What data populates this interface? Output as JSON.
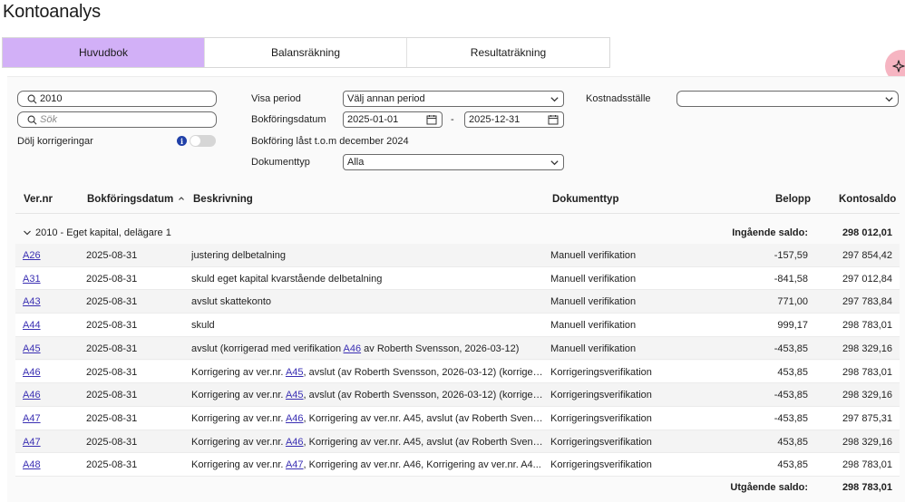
{
  "page": {
    "title": "Kontoanalys"
  },
  "tabs": [
    {
      "label": "Huvudbok",
      "active": true
    },
    {
      "label": "Balansräkning",
      "active": false
    },
    {
      "label": "Resultaträkning",
      "active": false
    }
  ],
  "colors": {
    "active_tab": "#d2b0f7",
    "link": "#3a2fb3",
    "fab": "#f6b5c2",
    "info": "#2040a8"
  },
  "filters": {
    "account_search_value": "2010",
    "search_placeholder": "Sök",
    "hide_corrections_label": "Dölj korrigeringar",
    "hide_corrections_on": false,
    "period_label": "Visa period",
    "period_value": "Välj annan period",
    "booking_date_label": "Bokföringsdatum",
    "date_from": "2025-01-01",
    "date_separator": "-",
    "date_to": "2025-12-31",
    "locked_note": "Bokföring låst t.o.m december 2024",
    "doc_type_label": "Dokumenttyp",
    "doc_type_value": "Alla",
    "cost_center_label": "Kostnadsställe",
    "cost_center_value": ""
  },
  "table": {
    "headers": {
      "ver": "Ver.nr",
      "date": "Bokföringsdatum",
      "desc": "Beskrivning",
      "type": "Dokumenttyp",
      "amount": "Belopp",
      "balance": "Kontosaldo"
    },
    "sort_indicator": "^",
    "group": {
      "label": "2010 - Eget kapital, delägare 1",
      "opening_label": "Ingående saldo:",
      "opening_value": "298 012,01"
    },
    "rows": [
      {
        "ver": "A26",
        "date": "2025-08-31",
        "desc_pre": "justering delbetalning",
        "desc_link": "",
        "desc_post": "",
        "type": "Manuell verifikation",
        "amount": "-157,59",
        "balance": "297 854,42"
      },
      {
        "ver": "A31",
        "date": "2025-08-31",
        "desc_pre": "skuld eget kapital kvarstående delbetalning",
        "desc_link": "",
        "desc_post": "",
        "type": "Manuell verifikation",
        "amount": "-841,58",
        "balance": "297 012,84"
      },
      {
        "ver": "A43",
        "date": "2025-08-31",
        "desc_pre": "avslut skattekonto",
        "desc_link": "",
        "desc_post": "",
        "type": "Manuell verifikation",
        "amount": "771,00",
        "balance": "297 783,84"
      },
      {
        "ver": "A44",
        "date": "2025-08-31",
        "desc_pre": "skuld",
        "desc_link": "",
        "desc_post": "",
        "type": "Manuell verifikation",
        "amount": "999,17",
        "balance": "298 783,01"
      },
      {
        "ver": "A45",
        "date": "2025-08-31",
        "desc_pre": "avslut (korrigerad med verifikation ",
        "desc_link": "A46",
        "desc_post": " av Roberth Svensson, 2026-03-12)",
        "type": "Manuell verifikation",
        "amount": "-453,85",
        "balance": "298 329,16"
      },
      {
        "ver": "A46",
        "date": "2025-08-31",
        "desc_pre": "Korrigering av ver.nr. ",
        "desc_link": "A45",
        "desc_post": ", avslut (av Roberth Svensson, 2026-03-12) (korriger...",
        "type": "Korrigeringsverifikation",
        "amount": "453,85",
        "balance": "298 783,01"
      },
      {
        "ver": "A46",
        "date": "2025-08-31",
        "desc_pre": "Korrigering av ver.nr. ",
        "desc_link": "A45",
        "desc_post": ", avslut (av Roberth Svensson, 2026-03-12) (korriger...",
        "type": "Korrigeringsverifikation",
        "amount": "-453,85",
        "balance": "298 329,16"
      },
      {
        "ver": "A47",
        "date": "2025-08-31",
        "desc_pre": "Korrigering av ver.nr. ",
        "desc_link": "A46",
        "desc_post": ", Korrigering av ver.nr. A45, avslut (av Roberth Svens...",
        "type": "Korrigeringsverifikation",
        "amount": "-453,85",
        "balance": "297 875,31"
      },
      {
        "ver": "A47",
        "date": "2025-08-31",
        "desc_pre": "Korrigering av ver.nr. ",
        "desc_link": "A46",
        "desc_post": ", Korrigering av ver.nr. A45, avslut (av Roberth Svens...",
        "type": "Korrigeringsverifikation",
        "amount": "453,85",
        "balance": "298 329,16"
      },
      {
        "ver": "A48",
        "date": "2025-08-31",
        "desc_pre": "Korrigering av ver.nr. ",
        "desc_link": "A47",
        "desc_post": ", Korrigering av ver.nr. A46, Korrigering av ver.nr. A4...",
        "type": "Korrigeringsverifikation",
        "amount": "453,85",
        "balance": "298 783,01"
      }
    ],
    "closing_label": "Utgående saldo:",
    "closing_value": "298 783,01"
  }
}
